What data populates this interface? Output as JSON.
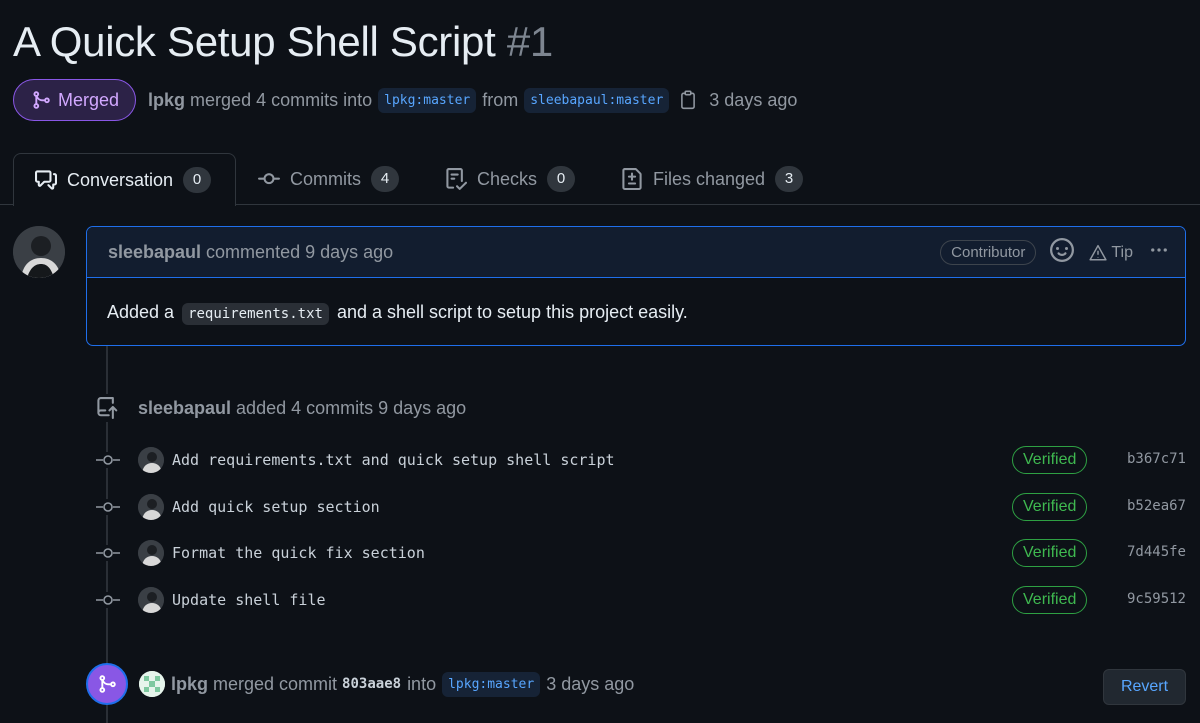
{
  "pr": {
    "title": "A Quick Setup Shell Script",
    "number": "#1",
    "state": "Merged",
    "merger": "lpkg",
    "merged_text": "merged 4 commits into",
    "base_branch": "lpkg:master",
    "from_text": "from",
    "head_branch": "sleebapaul:master",
    "time": "3 days ago"
  },
  "tabs": [
    {
      "label": "Conversation",
      "count": "0",
      "icon": "comment-discussion-icon"
    },
    {
      "label": "Commits",
      "count": "4",
      "icon": "git-commit-icon"
    },
    {
      "label": "Checks",
      "count": "0",
      "icon": "checklist-icon"
    },
    {
      "label": "Files changed",
      "count": "3",
      "icon": "file-diff-icon"
    }
  ],
  "comment": {
    "author": "sleebapaul",
    "action": "commented 9 days ago",
    "role": "Contributor",
    "tip_label": "Tip",
    "body_pre": "Added a",
    "body_code": "requirements.txt",
    "body_post": "and a shell script to setup this project easily."
  },
  "commits_event": {
    "author": "sleebapaul",
    "text": "added 4 commits 9 days ago"
  },
  "commits": [
    {
      "message": "Add requirements.txt and quick setup shell script",
      "badge": "Verified",
      "sha": "b367c71"
    },
    {
      "message": "Add quick setup section",
      "badge": "Verified",
      "sha": "b52ea67"
    },
    {
      "message": "Format the quick fix section",
      "badge": "Verified",
      "sha": "7d445fe"
    },
    {
      "message": "Update shell file",
      "badge": "Verified",
      "sha": "9c59512"
    }
  ],
  "merge_event": {
    "author": "lpkg",
    "text": "merged commit",
    "sha": "803aae8",
    "into_text": "into",
    "branch": "lpkg:master",
    "time": "3 days ago",
    "revert_label": "Revert"
  },
  "colors": {
    "background": "#0d1117",
    "merged_purple": "#8957e5",
    "link_blue": "#58a6ff",
    "verified_green": "#3fb950"
  }
}
